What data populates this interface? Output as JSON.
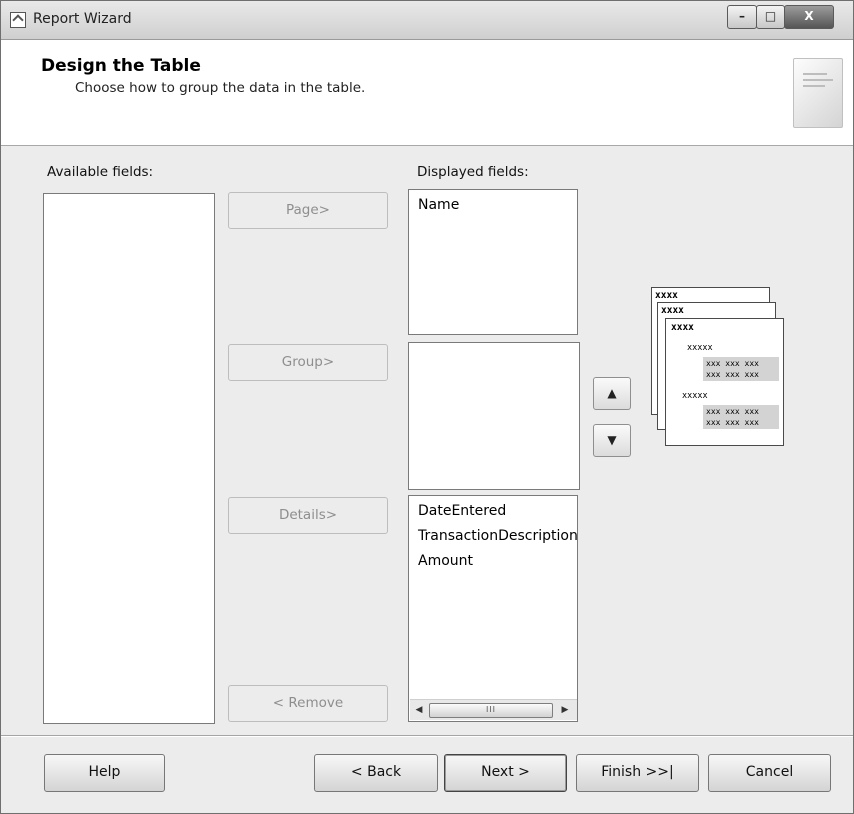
{
  "window": {
    "title": "Report Wizard",
    "controls": [
      "–",
      "□",
      "X"
    ]
  },
  "header": {
    "title": "Design the Table",
    "subtitle": "Choose how to group the data in the table."
  },
  "available": {
    "label": "Available fields:",
    "items": []
  },
  "displayed": {
    "label": "Displayed fields:",
    "page_items": [
      "Name"
    ],
    "group_items": [],
    "detail_items": [
      "DateEntered",
      "TransactionDescription",
      "Amount"
    ]
  },
  "move_buttons": {
    "page": "Page>",
    "group": "Group>",
    "details": "Details>",
    "remove": "< Remove"
  },
  "order_buttons": {
    "up": "▲",
    "down": "▼"
  },
  "scrollbar": {
    "left": "◀",
    "right": "▶",
    "thumb": "III"
  },
  "preview": {
    "header": "xxxx",
    "group": "xxxxx",
    "detail_row": "xxx xxx xxx"
  },
  "footer": {
    "help": "Help",
    "back": "< Back",
    "next": "Next >",
    "finish": "Finish >>|",
    "cancel": "Cancel"
  }
}
